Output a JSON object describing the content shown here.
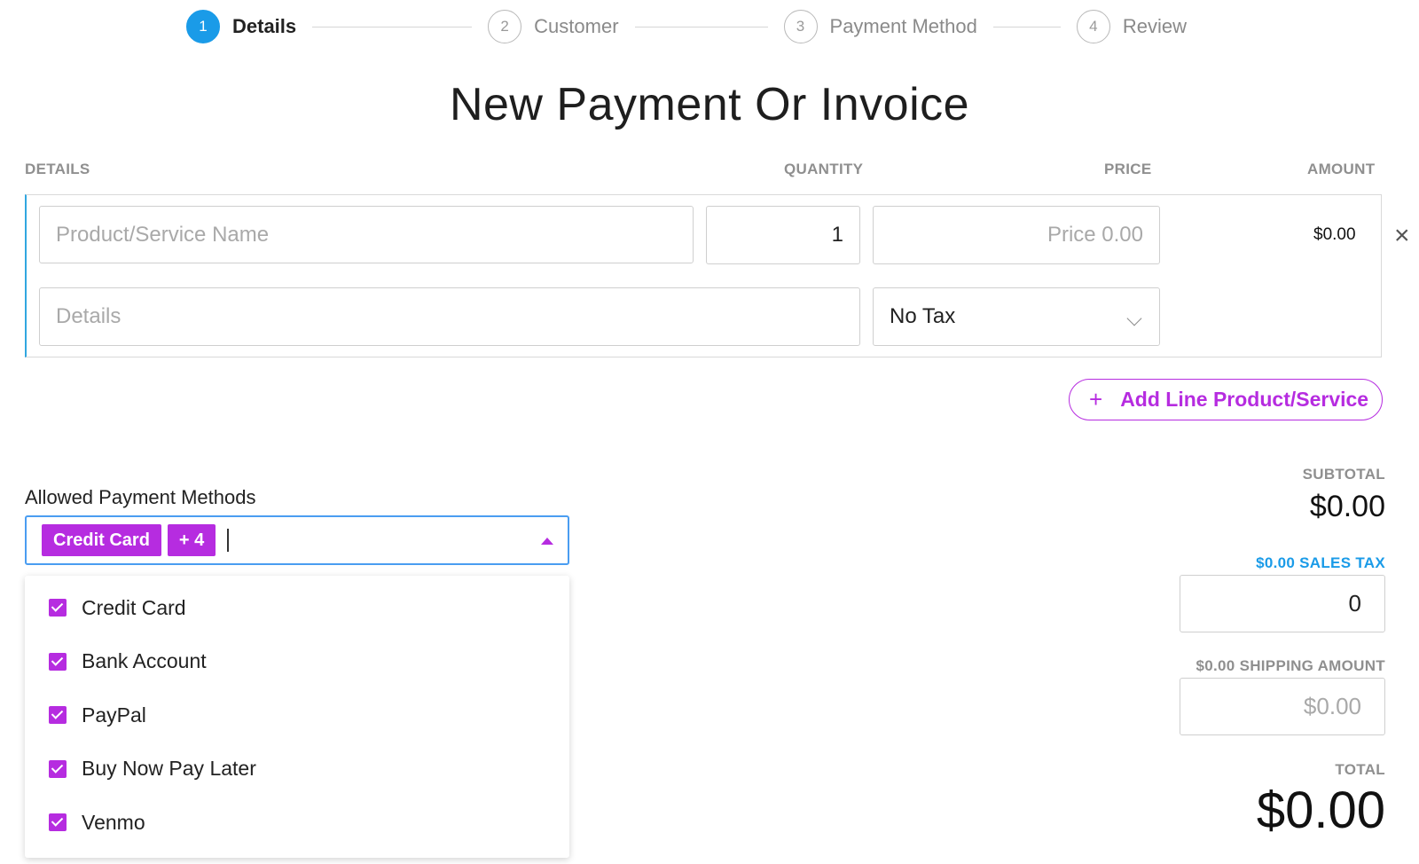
{
  "stepper": {
    "steps": [
      {
        "number": "1",
        "label": "Details"
      },
      {
        "number": "2",
        "label": "Customer"
      },
      {
        "number": "3",
        "label": "Payment Method"
      },
      {
        "number": "4",
        "label": "Review"
      }
    ],
    "active_step": 1
  },
  "page_title": "New Payment Or Invoice",
  "columns": {
    "details": "DETAILS",
    "quantity": "QUANTITY",
    "price": "PRICE",
    "amount": "AMOUNT"
  },
  "line_item": {
    "product_placeholder": "Product/Service Name",
    "quantity_value": "1",
    "price_placeholder": "Price 0.00",
    "details_placeholder": "Details",
    "tax_selected": "No Tax",
    "amount": "$0.00",
    "remove_glyph": "×"
  },
  "add_line": {
    "plus_glyph": "+",
    "label": "Add Line Product/Service"
  },
  "payment_methods": {
    "label": "Allowed Payment Methods",
    "chip_primary": "Credit Card",
    "chip_more": "+ 4",
    "options": [
      {
        "label": "Credit Card",
        "checked": true
      },
      {
        "label": "Bank Account",
        "checked": true
      },
      {
        "label": "PayPal",
        "checked": true
      },
      {
        "label": "Buy Now Pay Later",
        "checked": true
      },
      {
        "label": "Venmo",
        "checked": true
      }
    ]
  },
  "totals": {
    "subtotal_label": "SUBTOTAL",
    "subtotal_value": "$0.00",
    "sales_tax_label": "$0.00 SALES TAX",
    "sales_tax_value": "0",
    "shipping_label": "$0.00 SHIPPING AMOUNT",
    "shipping_placeholder": "$0.00",
    "total_label": "TOTAL",
    "total_value": "$0.00"
  },
  "colors": {
    "accent_purple": "#b62ce0",
    "accent_blue": "#1a9be8"
  }
}
